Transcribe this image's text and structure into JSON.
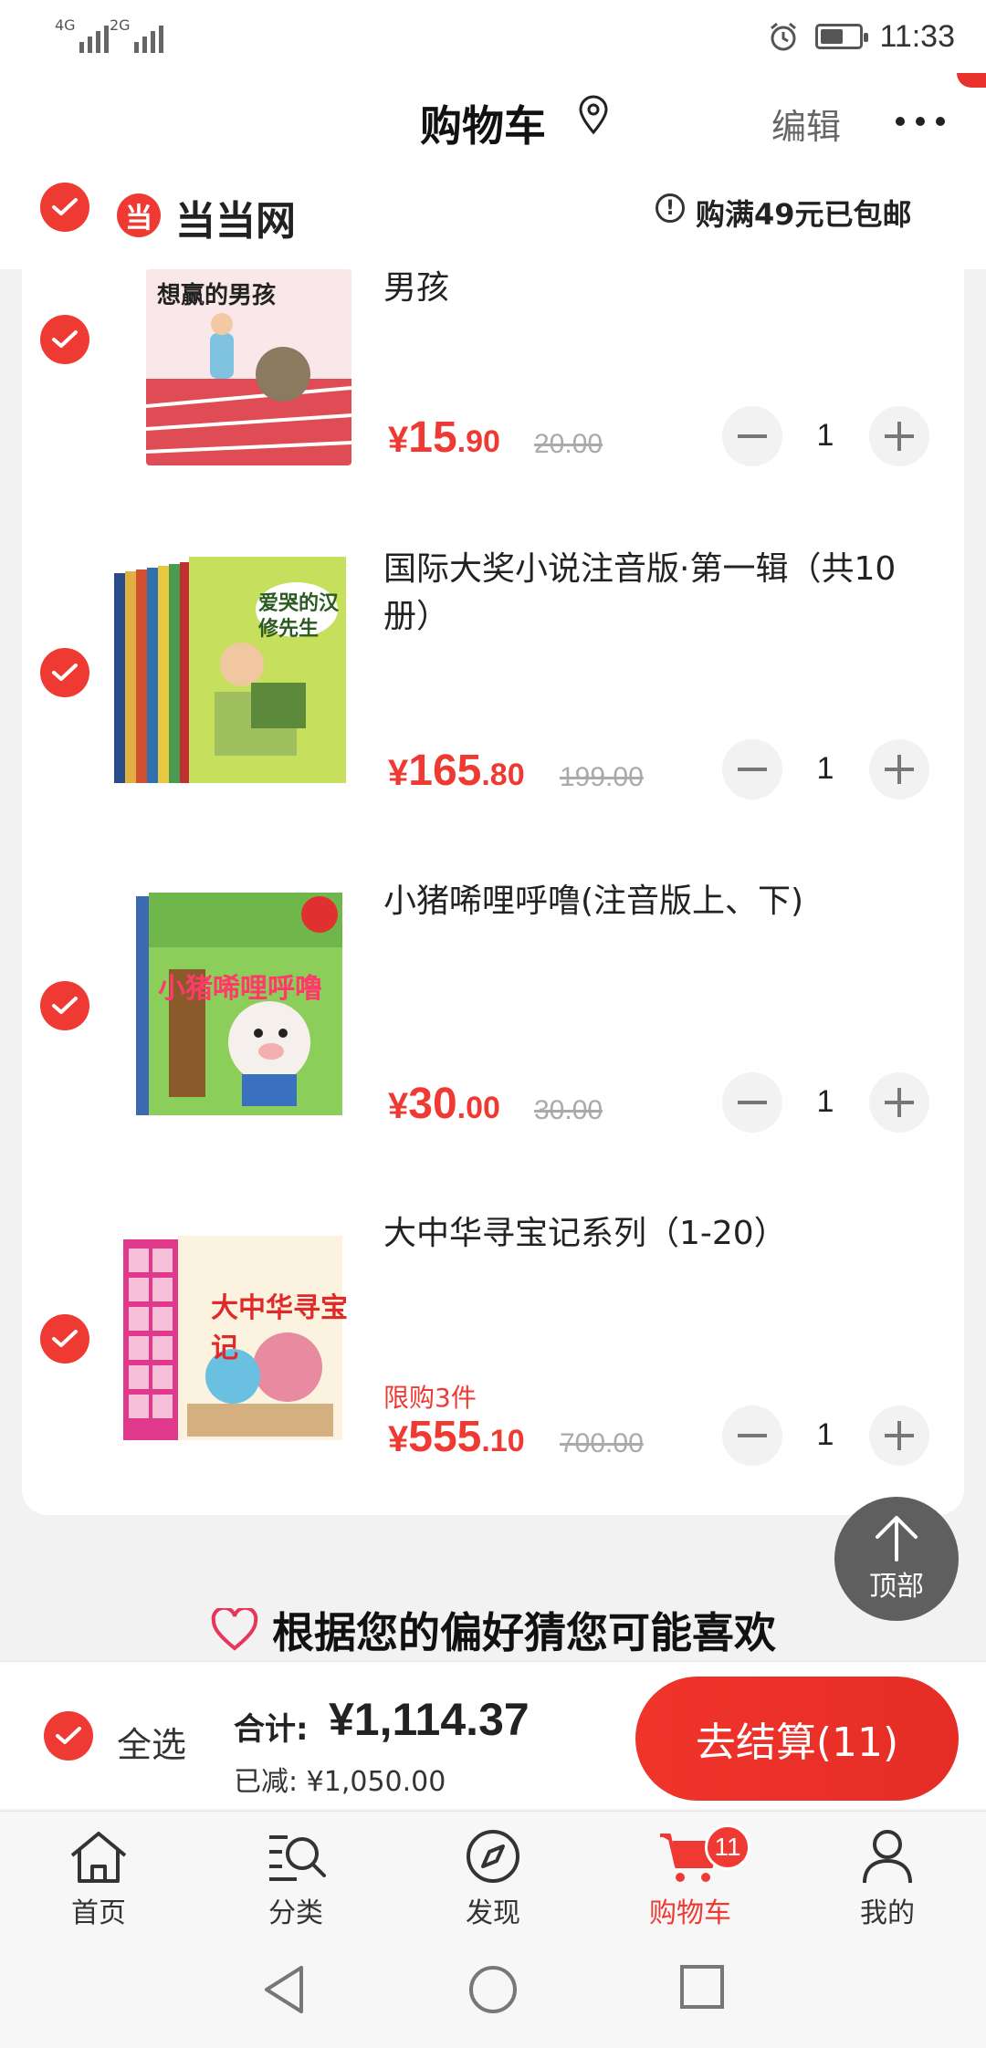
{
  "status_bar": {
    "sim1": "4G",
    "sim2": "2G",
    "time": "11:33",
    "battery_level": 0.6
  },
  "header": {
    "title": "购物车",
    "edit_label": "编辑",
    "more_icon": "more-icon",
    "location_icon": "location-pin-icon"
  },
  "store": {
    "logo_char": "当",
    "name": "当当网",
    "shipping_note": "购满49元已包邮",
    "shipping_icon_char": "!"
  },
  "items": [
    {
      "name": "男孩",
      "price_symbol": "¥",
      "price_int": "15",
      "price_dec": ".90",
      "original_price": "20.00",
      "quantity": "1",
      "limit": "",
      "cover_title": "想赢的男孩"
    },
    {
      "name": "国际大奖小说注音版·第一辑（共10册）",
      "price_symbol": "¥",
      "price_int": "165",
      "price_dec": ".80",
      "original_price": "199.00",
      "quantity": "1",
      "limit": "",
      "cover_title": "爱哭的汉修先生"
    },
    {
      "name": "小猪唏哩呼噜(注音版上、下)",
      "price_symbol": "¥",
      "price_int": "30",
      "price_dec": ".00",
      "original_price": "30.00",
      "quantity": "1",
      "limit": "",
      "cover_title": "小猪唏哩呼噜"
    },
    {
      "name": "大中华寻宝记系列（1-20）",
      "price_symbol": "¥",
      "price_int": "555",
      "price_dec": ".10",
      "original_price": "700.00",
      "quantity": "1",
      "limit": "限购3件",
      "cover_title": "大中华寻宝记"
    }
  ],
  "back_to_top": {
    "label": "顶部"
  },
  "recommend": {
    "title": "根据您的偏好猜您可能喜欢"
  },
  "checkout": {
    "select_all": "全选",
    "total_label": "合计:",
    "total_value": "¥1,114.37",
    "saved": "已减: ¥1,050.00",
    "pay_button": "去结算(11)"
  },
  "tabs": [
    {
      "label": "首页",
      "icon": "home-icon",
      "active": false
    },
    {
      "label": "分类",
      "icon": "category-search-icon",
      "active": false
    },
    {
      "label": "发现",
      "icon": "compass-icon",
      "active": false
    },
    {
      "label": "购物车",
      "icon": "cart-icon",
      "active": true,
      "badge": "11"
    },
    {
      "label": "我的",
      "icon": "user-icon",
      "active": false
    }
  ],
  "colors": {
    "accent": "#ee3a32",
    "background": "#f2f2f2"
  }
}
